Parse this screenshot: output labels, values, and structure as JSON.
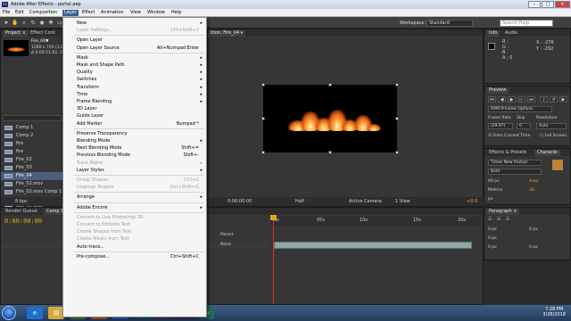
{
  "window": {
    "title": "Adobe After Effects - portal.aep",
    "app_icon": "Ae",
    "minimize": "–",
    "maximize": "□",
    "close": "✕"
  },
  "menubar": [
    "File",
    "Edit",
    "Composition",
    "Layer",
    "Effect",
    "Animation",
    "View",
    "Window",
    "Help"
  ],
  "toolbar": {
    "workspace_label": "Workspace:",
    "workspace_value": "Standard",
    "search_placeholder": "Search Help"
  },
  "project": {
    "tabs": [
      "Project ×",
      "Effect Cont"
    ],
    "selected_name": "Fire_04▼",
    "selected_info": [
      "1280 x 720 (1.00)",
      "Δ 0:00:21:02, 29.97 fps"
    ],
    "items": [
      {
        "name": "Comp 1",
        "selected": false
      },
      {
        "name": "Comp 2",
        "selected": false
      },
      {
        "name": "fire",
        "selected": false
      },
      {
        "name": "fire",
        "selected": false
      },
      {
        "name": "Fire_02",
        "selected": false
      },
      {
        "name": "Fire_03",
        "selected": false
      },
      {
        "name": "Fire_04",
        "selected": true
      },
      {
        "name": "Fire_02.mov",
        "selected": false
      },
      {
        "name": "Fire_02.mov Comp 1",
        "selected": false
      },
      {
        "name": "Fire_03.mov",
        "selected": false
      },
      {
        "name": "Fire_04.mov",
        "selected": false
      },
      {
        "name": "Fire_05.mov",
        "selected": false
      },
      {
        "name": "Pre-comp 1",
        "selected": false
      }
    ],
    "bpc": "8 bpc"
  },
  "layer_menu": [
    {
      "label": "New",
      "submenu": true,
      "disabled": false,
      "shortcut": ""
    },
    {
      "label": "Layer Settings...",
      "submenu": false,
      "disabled": true,
      "shortcut": "Ctrl+Shift+Y"
    },
    {
      "sep": true
    },
    {
      "label": "Open Layer",
      "submenu": false,
      "disabled": false,
      "shortcut": ""
    },
    {
      "label": "Open Layer Source",
      "submenu": false,
      "disabled": false,
      "shortcut": "Alt+Numpad Enter"
    },
    {
      "sep": true
    },
    {
      "label": "Mask",
      "submenu": true,
      "disabled": false,
      "shortcut": ""
    },
    {
      "label": "Mask and Shape Path",
      "submenu": true,
      "disabled": false,
      "shortcut": ""
    },
    {
      "label": "Quality",
      "submenu": true,
      "disabled": false,
      "shortcut": ""
    },
    {
      "label": "Switches",
      "submenu": true,
      "disabled": false,
      "shortcut": ""
    },
    {
      "label": "Transform",
      "submenu": true,
      "disabled": false,
      "shortcut": ""
    },
    {
      "label": "Time",
      "submenu": true,
      "disabled": false,
      "shortcut": ""
    },
    {
      "label": "Frame Blending",
      "submenu": true,
      "disabled": false,
      "shortcut": ""
    },
    {
      "label": "3D Layer",
      "submenu": false,
      "disabled": false,
      "shortcut": ""
    },
    {
      "label": "Guide Layer",
      "submenu": false,
      "disabled": false,
      "shortcut": ""
    },
    {
      "label": "Add Marker",
      "submenu": false,
      "disabled": false,
      "shortcut": "Numpad *"
    },
    {
      "sep": true
    },
    {
      "label": "Preserve Transparency",
      "submenu": false,
      "disabled": false,
      "shortcut": ""
    },
    {
      "label": "Blending Mode",
      "submenu": true,
      "disabled": false,
      "shortcut": ""
    },
    {
      "label": "Next Blending Mode",
      "submenu": false,
      "disabled": false,
      "shortcut": "Shift+="
    },
    {
      "label": "Previous Blending Mode",
      "submenu": false,
      "disabled": false,
      "shortcut": "Shift+-"
    },
    {
      "label": "Track Matte",
      "submenu": true,
      "disabled": true,
      "shortcut": ""
    },
    {
      "label": "Layer Styles",
      "submenu": true,
      "disabled": false,
      "shortcut": ""
    },
    {
      "sep": true
    },
    {
      "label": "Group Shapes",
      "submenu": false,
      "disabled": true,
      "shortcut": "Ctrl+G"
    },
    {
      "label": "Ungroup Shapes",
      "submenu": false,
      "disabled": true,
      "shortcut": "Ctrl+Shift+G"
    },
    {
      "sep": true
    },
    {
      "label": "Arrange",
      "submenu": true,
      "disabled": false,
      "shortcut": ""
    },
    {
      "sep": true
    },
    {
      "label": "Adobe Encore",
      "submenu": true,
      "disabled": false,
      "shortcut": ""
    },
    {
      "sep": true
    },
    {
      "label": "Convert to Live Photoshop 3D",
      "submenu": false,
      "disabled": true,
      "shortcut": ""
    },
    {
      "label": "Convert to Editable Text",
      "submenu": false,
      "disabled": true,
      "shortcut": ""
    },
    {
      "label": "Create Shapes from Text",
      "submenu": false,
      "disabled": true,
      "shortcut": ""
    },
    {
      "label": "Create Masks from Text",
      "submenu": false,
      "disabled": true,
      "shortcut": ""
    },
    {
      "label": "Auto-trace...",
      "submenu": false,
      "disabled": false,
      "shortcut": ""
    },
    {
      "sep": true
    },
    {
      "label": "Pre-compose...",
      "submenu": false,
      "disabled": false,
      "shortcut": "Ctrl+Shift+C"
    }
  ],
  "composition": {
    "tab_label": "ition: Fire_04 ▾",
    "footer": {
      "timecode": "0:00:00:00",
      "resolution": "Half",
      "camera": "Active Camera",
      "views": "1 View",
      "exposure": "+0.0"
    }
  },
  "info": {
    "tabs": [
      "Info",
      "Audio"
    ],
    "rgba": [
      "R :",
      "G :",
      "B :",
      "A : 0"
    ],
    "coords": [
      "X : -276",
      "Y : -292"
    ]
  },
  "preview": {
    "tab": "Preview",
    "ram_label": "RAM Preview Options",
    "frame_rate_label": "Frame Rate",
    "skip_label": "Skip",
    "resolution_label": "Resolution",
    "frame_rate": "(29.97)",
    "skip": "0",
    "resolution": "Auto",
    "from_current": "From Current Time",
    "full_screen": "Full Screen"
  },
  "character": {
    "tabs": [
      "Effects & Presets",
      "Characte"
    ],
    "font": "Times New Roman",
    "style": "Bold",
    "size": "60 px",
    "leading": "Auto",
    "tracking": "Metrics",
    "kerning": "30",
    "stroke": "px",
    "scale": "100 %",
    "percent2": "100 %",
    "baseline": "0 px",
    "tsume": "0 %",
    "fill_color": "#c8811f"
  },
  "paragraph": {
    "tab": "Paragraph ×",
    "indent_values": [
      "0 px",
      "0 px",
      "0 px",
      "0 px",
      "0 px"
    ]
  },
  "timeline": {
    "tabs": [
      "Render Queue",
      "Comp 1"
    ],
    "timecode": "0:00:00:00",
    "parent_label": "Parent",
    "parent_value": "None",
    "ruler": [
      "0s",
      "05s",
      "10s",
      "15s",
      "20s"
    ]
  },
  "taskbar": {
    "time": "7:28 PM",
    "date": "3/28/2018",
    "apps": [
      "ie-icon",
      "folder-icon",
      "chrome-icon",
      "firefox-icon",
      "media-icon",
      "ps-icon",
      "pr-icon",
      "ae-icon",
      "audition-icon"
    ]
  }
}
